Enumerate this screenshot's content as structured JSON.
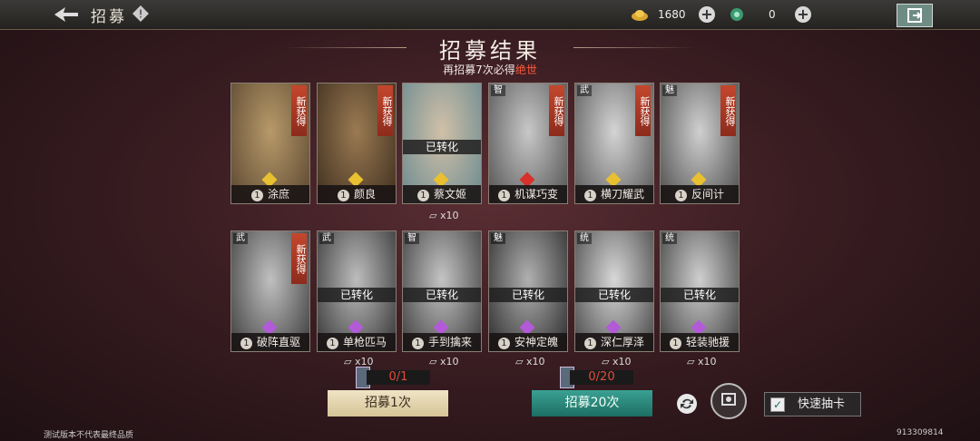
{
  "topbar": {
    "title": "招募",
    "gold": "1680",
    "jade": "0"
  },
  "heading": {
    "title": "招募结果",
    "pity_prefix": "再招募7次必得",
    "pity_highlight": "绝世"
  },
  "cards": [
    {
      "level": "1",
      "name": "涂庶",
      "new": "新获得",
      "tag": "",
      "converted": "",
      "gem": "gold",
      "dup": ""
    },
    {
      "level": "1",
      "name": "颜良",
      "new": "新获得",
      "tag": "",
      "converted": "",
      "gem": "gold",
      "dup": ""
    },
    {
      "level": "1",
      "name": "蔡文姬",
      "new": "",
      "tag": "",
      "converted": "已转化",
      "gem": "gold",
      "dup": "x10"
    },
    {
      "level": "1",
      "name": "机谋巧变",
      "new": "新获得",
      "tag": "智",
      "converted": "",
      "gem": "red",
      "dup": ""
    },
    {
      "level": "1",
      "name": "横刀耀武",
      "new": "新获得",
      "tag": "武",
      "converted": "",
      "gem": "gold",
      "dup": ""
    },
    {
      "level": "1",
      "name": "反间计",
      "new": "新获得",
      "tag": "魅",
      "converted": "",
      "gem": "gold",
      "dup": ""
    },
    {
      "level": "1",
      "name": "破阵直驱",
      "new": "新获得",
      "tag": "武",
      "converted": "",
      "gem": "purple",
      "dup": ""
    },
    {
      "level": "1",
      "name": "单枪匹马",
      "new": "",
      "tag": "武",
      "converted": "已转化",
      "gem": "purple",
      "dup": "x10"
    },
    {
      "level": "1",
      "name": "手到擒来",
      "new": "",
      "tag": "智",
      "converted": "已转化",
      "gem": "purple",
      "dup": "x10"
    },
    {
      "level": "1",
      "name": "安神定魄",
      "new": "",
      "tag": "魅",
      "converted": "已转化",
      "gem": "purple",
      "dup": "x10"
    },
    {
      "level": "1",
      "name": "深仁厚泽",
      "new": "",
      "tag": "统",
      "converted": "已转化",
      "gem": "purple",
      "dup": "x10"
    },
    {
      "level": "1",
      "name": "轻装驰援",
      "new": "",
      "tag": "统",
      "converted": "已转化",
      "gem": "purple",
      "dup": "x10"
    }
  ],
  "actions": {
    "single_label": "招募1次",
    "single_count": "0/1",
    "multi_label": "招募20次",
    "multi_count": "0/20",
    "quick_draw": "快速抽卡",
    "quick_draw_checked": true
  },
  "footer": {
    "disclaimer": "测试版本不代表最终品质",
    "build": "913309814"
  },
  "colors": {
    "new_badge": "#c4472d",
    "pity_red": "#ff5a3c",
    "gold_gem": "#e8c030",
    "purple_gem": "#b25ad8",
    "red_gem": "#d8302a",
    "btn_green": "#2a8a7c",
    "btn_cream": "#e4d6ae"
  }
}
